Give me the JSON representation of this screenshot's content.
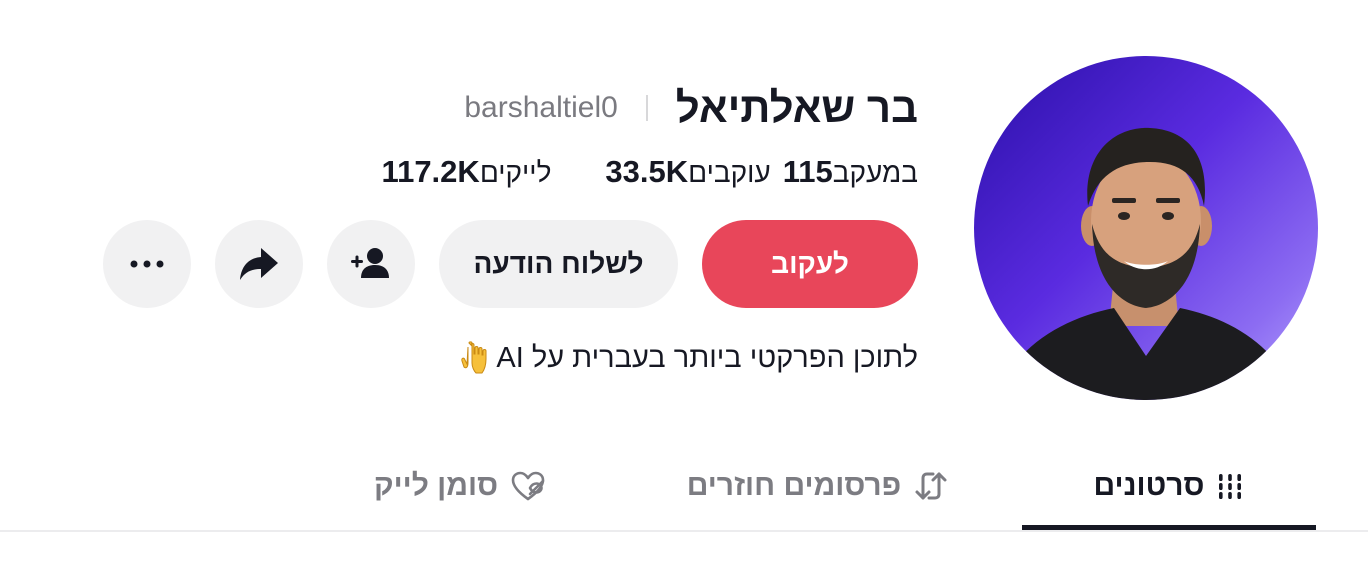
{
  "profile": {
    "display_name": "בר שאלתיאל",
    "username": "barshaltiel0",
    "bio": "לתוכן הפרקטי ביותר בעברית על AI",
    "bio_emoji": "pointing-down-hand-icon"
  },
  "stats": [
    {
      "value": "115",
      "label": "במעקב"
    },
    {
      "value": "33.5K",
      "label": "עוקבים"
    },
    {
      "value": "117.2K",
      "label": "לייקים"
    }
  ],
  "actions": {
    "follow_label": "לעקוב",
    "message_label": "לשלוח הודעה",
    "add_friend_icon": "add-user-icon",
    "share_icon": "share-arrow-icon",
    "more_icon": "more-dots-icon"
  },
  "tabs": [
    {
      "label": "סרטונים",
      "icon": "grid-icon",
      "active": true
    },
    {
      "label": "פרסומים חוזרים",
      "icon": "repost-icon",
      "active": false
    },
    {
      "label": "סומן לייק",
      "icon": "hidden-heart-icon",
      "active": false
    }
  ],
  "colors": {
    "follow_button": "#e8465a",
    "secondary_button": "#f1f1f2",
    "text_primary": "#161823",
    "text_secondary": "#7c7c82",
    "avatar_background": "#5a2be0"
  }
}
